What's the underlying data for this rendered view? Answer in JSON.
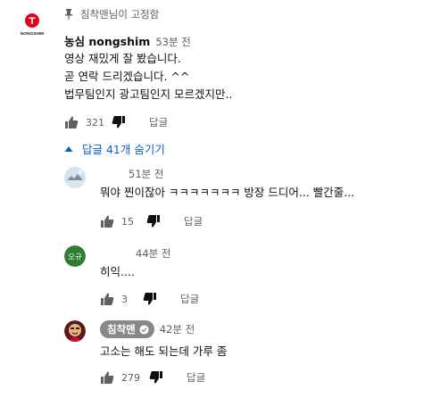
{
  "pinned_label": "침착맨님이 고정함",
  "main_comment": {
    "avatar_text": "NONGSHIM",
    "author": "농심 nongshim",
    "time": "53분 전",
    "lines": [
      "영상 재밌게 잘 봤습니다.",
      "곧 연락 드리겠습니다. ^^",
      "법무팀인지 광고팀인지 모르겠지만.."
    ],
    "likes": "321",
    "reply_label": "답글"
  },
  "replies_toggle": {
    "label": "답글 41개 숨기기"
  },
  "replies": [
    {
      "author": "",
      "time": "51분 전",
      "text": "뭐야 찐이잖아 ㅋㅋㅋㅋㅋㅋㅋ 방장 드디어... 빨간줄...",
      "likes": "15",
      "reply_label": "답글"
    },
    {
      "author": "",
      "avatar_text": "오규",
      "time": "44분 전",
      "text": "히익....",
      "likes": "3",
      "reply_label": "답글"
    },
    {
      "author": "침착맨",
      "time": "42분 전",
      "text": "고소는 해도 되는데 가루 좀",
      "likes": "279",
      "reply_label": "답글"
    }
  ],
  "colors": {
    "link": "#065fd4",
    "muted": "#606060",
    "nongshim_red": "#e2001a",
    "avatar_green": "#2e7d32"
  }
}
